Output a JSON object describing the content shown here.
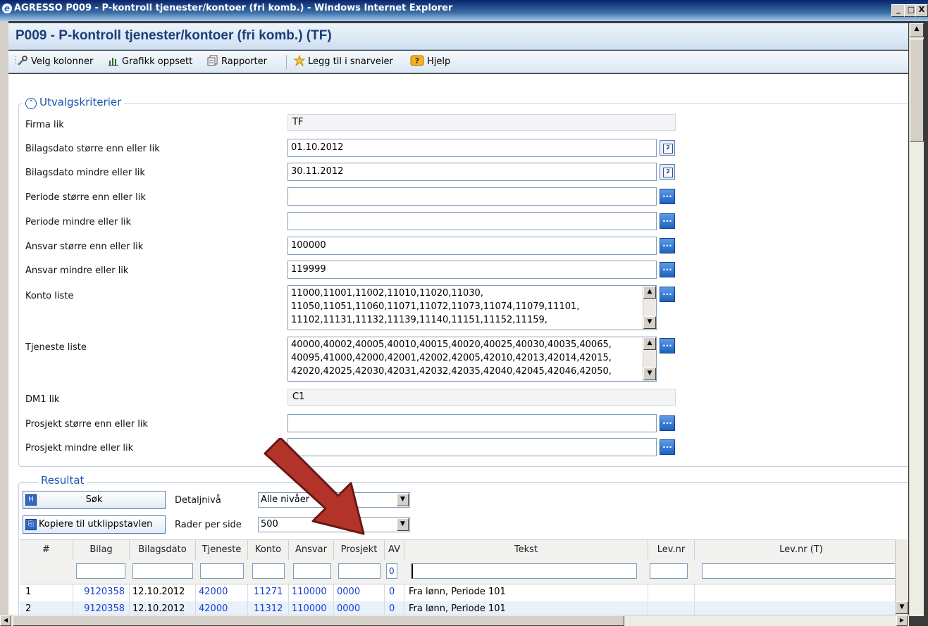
{
  "window": {
    "title": "AGRESSO P009 - P-kontroll tjenester/kontoer (fri komb.) - Windows Internet Explorer",
    "ie_icon": "e",
    "controls": [
      "_",
      "□",
      "X"
    ]
  },
  "page": {
    "title": "P009 - P-kontroll tjenester/kontoer (fri komb.) (TF)"
  },
  "toolbar": {
    "velg_kolonner": "Velg kolonner",
    "grafikk": "Grafikk oppsett",
    "rapporter": "Rapporter",
    "snarveier": "Legg til i snarveier",
    "hjelp": "Hjelp"
  },
  "criteria": {
    "legend": "Utvalgskriterier",
    "collapse_glyph": "⌃",
    "fields": [
      {
        "label": "Firma lik",
        "value": "TF"
      },
      {
        "label": "Bilagsdato større enn eller lik",
        "value": "01.10.2012"
      },
      {
        "label": "Bilagsdato mindre eller lik",
        "value": "30.11.2012"
      },
      {
        "label": "Periode større enn eller lik",
        "value": ""
      },
      {
        "label": "Periode mindre eller lik",
        "value": ""
      },
      {
        "label": "Ansvar større enn eller lik",
        "value": "100000"
      },
      {
        "label": "Ansvar mindre eller lik",
        "value": "119999"
      },
      {
        "label": "Konto liste",
        "lines": [
          "11000,11001,11002,11010,11020,11030,",
          "11050,11051,11060,11071,11072,11073,11074,11079,11101,",
          "11102,11131,11132,11139,11140,11151,11152,11159,"
        ]
      },
      {
        "label": "Tjeneste liste",
        "lines": [
          "40000,40002,40005,40010,40015,40020,40025,40030,40035,40065,",
          "40095,41000,42000,42001,42002,42005,42010,42013,42014,42015,",
          "42020,42025,42030,42031,42032,42035,42040,42045,42046,42050,"
        ]
      },
      {
        "label": "DM1 lik",
        "value": "C1"
      },
      {
        "label": "Prosjekt større enn eller lik",
        "value": ""
      },
      {
        "label": "Prosjekt mindre eller lik",
        "value": ""
      }
    ],
    "lookup_glyph": "...",
    "calendar_glyph": "2"
  },
  "result": {
    "legend": "Resultat",
    "search_button": "Søk",
    "copy_button": "Kopiere til utklippstavlen",
    "detail_label": "Detaljnivå",
    "detail_value": "Alle nivåer",
    "rows_label": "Rader per side",
    "rows_value": "500"
  },
  "grid": {
    "columns": [
      "#",
      "Bilag",
      "Bilagsdato",
      "Tjeneste",
      "Konto",
      "Ansvar",
      "Prosjekt",
      "AV",
      "Tekst",
      "Lev.nr",
      "Lev.nr (T)"
    ],
    "filter_av": "0",
    "rows": [
      {
        "num": "1",
        "bilag": "9120358",
        "dato": "12.10.2012",
        "tjeneste": "42000",
        "konto": "11271",
        "ansvar": "110000",
        "prosjekt": "0000",
        "av": "0",
        "tekst": "Fra lønn, Periode 101",
        "levnr": "",
        "levnrt": ""
      },
      {
        "num": "2",
        "bilag": "9120358",
        "dato": "12.10.2012",
        "tjeneste": "42000",
        "konto": "11312",
        "ansvar": "110000",
        "prosjekt": "0000",
        "av": "0",
        "tekst": "Fra lønn, Periode 101",
        "levnr": "",
        "levnrt": ""
      }
    ]
  },
  "colors": {
    "title_bar": "#0a246a",
    "heading": "#1a3e78",
    "legend": "#1a53b0",
    "link": "#1a3fd1",
    "arrow": "#b3332b"
  }
}
